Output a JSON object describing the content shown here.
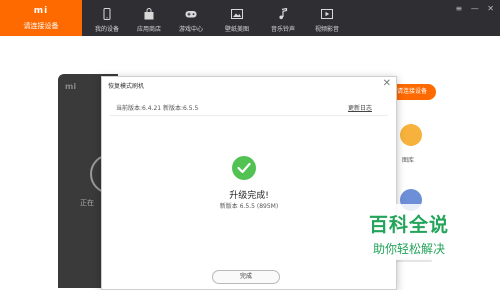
{
  "brand": {
    "logo_text": "mi",
    "label": "请连接设备"
  },
  "nav": [
    {
      "label": "我的设备",
      "icon": "phone-icon"
    },
    {
      "label": "应用商店",
      "icon": "store-bag-icon"
    },
    {
      "label": "游戏中心",
      "icon": "gamepad-icon"
    },
    {
      "label": "壁纸美图",
      "icon": "image-icon"
    },
    {
      "label": "音乐铃声",
      "icon": "music-note-icon"
    },
    {
      "label": "视频影音",
      "icon": "video-play-icon"
    }
  ],
  "window_controls": {
    "menu": "≡",
    "minimize": "—",
    "close": "✕"
  },
  "background": {
    "phone_logo": "mi",
    "phone_status": "正在",
    "connect_button": "请连接设备",
    "gallery_label": "图库"
  },
  "dialog": {
    "title": "恢复模式刷机",
    "close": "✕",
    "versions": "当前版本:6.4.21  新版本:6.5.5",
    "changelog_link": "更新日志",
    "heading": "升级完成!",
    "new_version": "新版本 6.5.5 (895M)",
    "done_button": "完成"
  },
  "watermark": {
    "main": "百科全说",
    "sub": "助你轻松解决"
  },
  "colors": {
    "brand": "#ff6a00",
    "topbar": "#2f2f33",
    "success": "#52c252",
    "watermark": "#23a45a"
  }
}
